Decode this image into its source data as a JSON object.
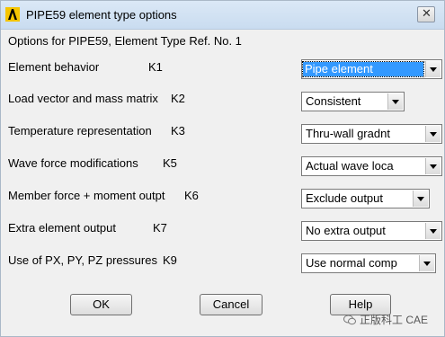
{
  "window": {
    "title": "PIPE59 element type options",
    "close_glyph": "✕"
  },
  "subtitle": "Options for PIPE59, Element Type Ref. No. 1",
  "options": [
    {
      "label": "Element behavior",
      "key": "K1",
      "value": "Pipe element"
    },
    {
      "label": "Load vector and mass matrix",
      "key": "K2",
      "value": "Consistent"
    },
    {
      "label": "Temperature representation",
      "key": "K3",
      "value": "Thru-wall gradnt"
    },
    {
      "label": "Wave force modifications",
      "key": "K5",
      "value": "Actual wave loca"
    },
    {
      "label": "Member force + moment outpt",
      "key": "K6",
      "value": "Exclude output"
    },
    {
      "label": "Extra element output",
      "key": "K7",
      "value": "No extra output"
    },
    {
      "label": "Use of PX, PY, PZ pressures",
      "key": "K9",
      "value": "Use normal comp"
    }
  ],
  "buttons": {
    "ok": "OK",
    "cancel": "Cancel",
    "help": "Help"
  },
  "watermark": "正版科工 CAE",
  "colors": {
    "selection": "#3399ff",
    "logo": "#f5c400"
  }
}
